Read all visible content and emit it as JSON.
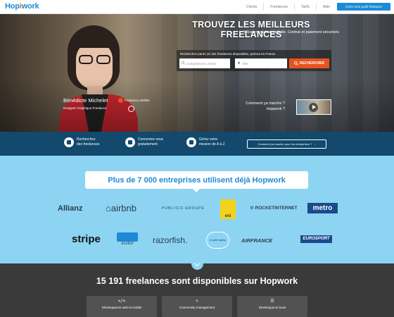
{
  "brand": {
    "logo_prefix": "Hop",
    "logo_dot": "i",
    "logo_suffix": "work"
  },
  "nav": {
    "links": [
      "Clients",
      "Freelances",
      "Tarifs",
      "Aide"
    ],
    "signup": "Créer mon profil freelance"
  },
  "hero": {
    "title": "TROUVEZ LES MEILLEURS FREELANCES",
    "subtitle": "Mise en relation gratuite. Contrat et paiement sécurisés",
    "search_label": "Recherchez parmi 15 191 freelances disponibles, partout en France",
    "skill_placeholder": "Compétences, métier",
    "city_placeholder": "Ville",
    "search_button": "RECHERCHER",
    "freelancer_name": "Bénédicte Michelet",
    "freelancer_job": "Designer Graphique Freelance",
    "badge_label": "Freelance vérifiée",
    "video_text_1": "Comment ça marche ?",
    "video_text_2": "Hopwork ?"
  },
  "features": {
    "items": [
      {
        "line1": "Recherchez",
        "line2": "des freelances"
      },
      {
        "line1": "Connectez-vous",
        "line2": "gratuitement"
      },
      {
        "line1": "Gérez votre",
        "line2": "mission de A à Z"
      }
    ],
    "cta": "Comment ça marche pour les entreprises ?"
  },
  "clients": {
    "banner": "Plus de 7 000 entreprises utilisent déjà Hopwork",
    "logos": [
      "Allianz",
      "airbnb",
      "PUBLICIS GROUPE",
      "eni",
      "ROCKETINTERNET",
      "metro",
      "stripe",
      "essilor",
      "razorfish.",
      "le petit ballon",
      "AIRFRANCE",
      "EUROSPORT"
    ]
  },
  "stats": {
    "headline": "15 191 freelances sont disponibles sur Hopwork",
    "categories": [
      {
        "icon": "</>",
        "label": "Développeurs web et mobile"
      },
      {
        "icon": "✎",
        "label": "Community management"
      },
      {
        "icon": "☰",
        "label": "Développeurs back"
      }
    ]
  },
  "colors": {
    "brand": "#1d8ad6",
    "accent": "#e8531e",
    "navy": "#12496c",
    "sky": "#8dd4f2",
    "dark": "#3a3a3a"
  }
}
